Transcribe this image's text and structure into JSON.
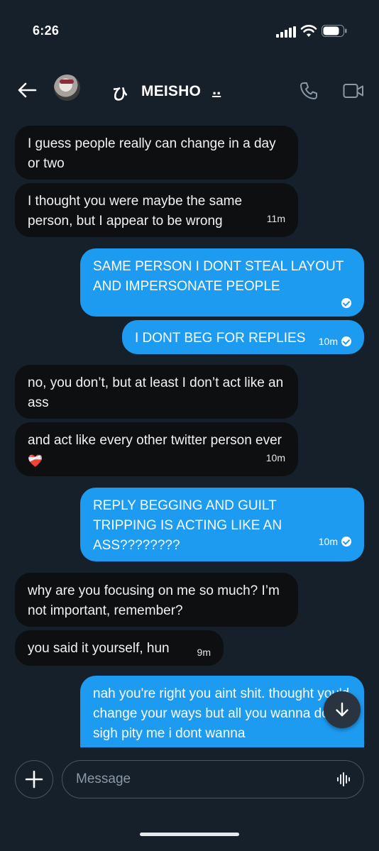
{
  "status_bar": {
    "time": "6:26",
    "signal_icon": "signal-bars-icon",
    "wifi_icon": "wifi-icon",
    "battery_icon": "battery-icon"
  },
  "header": {
    "back_icon": "arrow-left-icon",
    "name_glyph": "ひ",
    "name": "MEISHO",
    "name_suffix": "..",
    "phone_icon": "phone-icon",
    "video_icon": "video-camera-icon"
  },
  "messages": [
    {
      "direction": "in",
      "text": "I guess people really can change in a day or two"
    },
    {
      "direction": "in",
      "text": "I thought you were maybe the same person, but I appear to be wrong",
      "time": "11m"
    },
    {
      "direction": "out",
      "text": "SAME PERSON I DONT STEAL LAYOUT AND IMPERSONATE PEOPLE",
      "read": true
    },
    {
      "direction": "out",
      "text": "I DONT BEG FOR REPLIES",
      "time": "10m",
      "read": true
    },
    {
      "direction": "in",
      "text": "no, you don’t, but at least I don’t act like an ass"
    },
    {
      "direction": "in",
      "text": "and act like every other twitter person ever",
      "emoji": "❤️‍🩹",
      "time": "10m"
    },
    {
      "direction": "out",
      "text": "REPLY BEGGING AND GUILT TRIPPING IS ACTING LIKE AN ASS????????",
      "time": "10m",
      "read": true
    },
    {
      "direction": "in",
      "text": "why are you focusing on me so much? I’m not important, remember?"
    },
    {
      "direction": "in",
      "text": "you said it yourself, hun",
      "time": "9m"
    },
    {
      "direction": "out",
      "text": "nah you're right you aint shit. thought you'd change your ways but all you wanna do is sigh pity me i dont wanna"
    }
  ],
  "scroll_button": {
    "icon": "arrow-down-icon"
  },
  "composer": {
    "plus_icon": "plus-icon",
    "placeholder": "Message",
    "audio_icon": "audio-waveform-icon"
  },
  "colors": {
    "background": "#15202b",
    "incoming_bubble": "#0e0f11",
    "outgoing_bubble": "#1d9bf0"
  }
}
